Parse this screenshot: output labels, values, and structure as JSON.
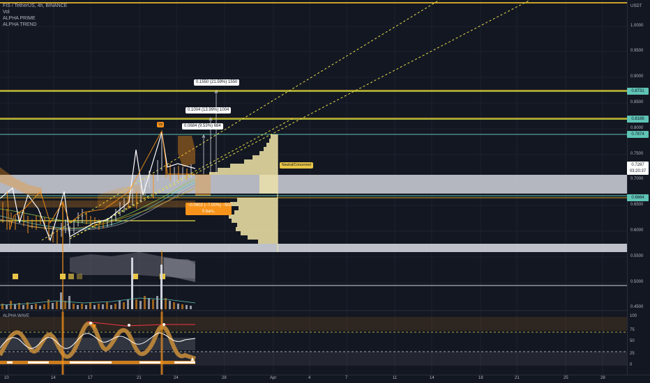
{
  "legend": {
    "symbol_line": "FIS / TetherUS, 4h, BINANCE",
    "vol": "Vol",
    "alpha_prime": "ALPHA PRIME",
    "alpha_trend": "ALPHA TREND"
  },
  "price_axis": {
    "currency": "USDT",
    "labels": [
      "1.0000",
      "0.9500",
      "0.9000",
      "0.8500",
      "0.8000",
      "0.7500",
      "0.7000",
      "0.6500",
      "0.6000",
      "0.5500",
      "0.5000",
      "0.4500"
    ]
  },
  "price_badges": {
    "b1": "0.8731",
    "b2": "0.8186",
    "b3": "0.7874",
    "current": "0.7287",
    "countdown": "03:20:37",
    "b5": "0.6664"
  },
  "measure_boxes": {
    "m1": "0.1550 (21.59%) 1550",
    "m2": "0.1004 (13.99%) 1004",
    "m3": "0.0684 (9.53%) 684",
    "m4_line1": "−0.0502 (−7.00%) −502",
    "m4_line2": "0 bars,"
  },
  "annotations": {
    "vp_marker": "Vp",
    "neutral": "Neutral/Concerned"
  },
  "time_axis": {
    "labels": [
      "10",
      "14",
      "17",
      "21",
      "24",
      "28",
      "Apr",
      "4",
      "7",
      "11",
      "14",
      "18",
      "21",
      "25",
      "28"
    ]
  },
  "oscillator": {
    "title": "ALPHA WAVE",
    "levels": [
      "100",
      "75",
      "50",
      "25",
      "0"
    ]
  },
  "colors": {
    "background": "#131722",
    "accent_orange": "#f7931a",
    "gold_line": "#c9a227",
    "teal_line": "#5fc4b6",
    "yellow_dash": "#e8e04a"
  }
}
